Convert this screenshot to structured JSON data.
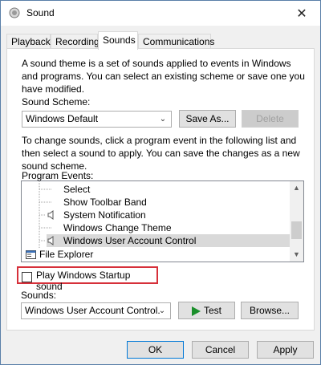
{
  "window": {
    "title": "Sound",
    "close_glyph": "✕"
  },
  "tabs": [
    {
      "label": "Playback"
    },
    {
      "label": "Recording"
    },
    {
      "label": "Sounds"
    },
    {
      "label": "Communications"
    }
  ],
  "description": {
    "line1": "A sound theme is a set of sounds applied to events in Windows",
    "line2": "and programs.  You can select an existing scheme or save one you",
    "line3": "have modified."
  },
  "scheme": {
    "label": "Sound Scheme:",
    "value": "Windows Default",
    "save_as": "Save As...",
    "delete": "Delete"
  },
  "instructions": {
    "line1": "To change sounds, click a program event in the following list and",
    "line2": "then select a sound to apply.  You can save the changes as a new",
    "line3": "sound scheme."
  },
  "events": {
    "label": "Program Events:",
    "items": [
      {
        "label": "Select",
        "has_sound": false,
        "selected": false,
        "group": false
      },
      {
        "label": "Show Toolbar Band",
        "has_sound": false,
        "selected": false,
        "group": false
      },
      {
        "label": "System Notification",
        "has_sound": true,
        "selected": false,
        "group": false
      },
      {
        "label": "Windows Change Theme",
        "has_sound": false,
        "selected": false,
        "group": false
      },
      {
        "label": "Windows User Account Control",
        "has_sound": true,
        "selected": true,
        "group": false
      },
      {
        "label": "File Explorer",
        "has_sound": false,
        "selected": false,
        "group": true
      }
    ]
  },
  "startup": {
    "label": "Play Windows Startup sound",
    "checked": false
  },
  "sounds": {
    "label": "Sounds:",
    "value": "Windows User Account Control.",
    "test": "Test",
    "browse": "Browse..."
  },
  "footer": {
    "ok": "OK",
    "cancel": "Cancel",
    "apply": "Apply"
  },
  "colors": {
    "highlight_border": "#d6303a",
    "accent": "#0078d7",
    "play_green": "#1a8f2b"
  },
  "icons": [
    "speaker-icon",
    "close-icon",
    "play-icon",
    "folder-icon",
    "chevron-down-icon",
    "scroll-up-icon",
    "scroll-down-icon"
  ]
}
